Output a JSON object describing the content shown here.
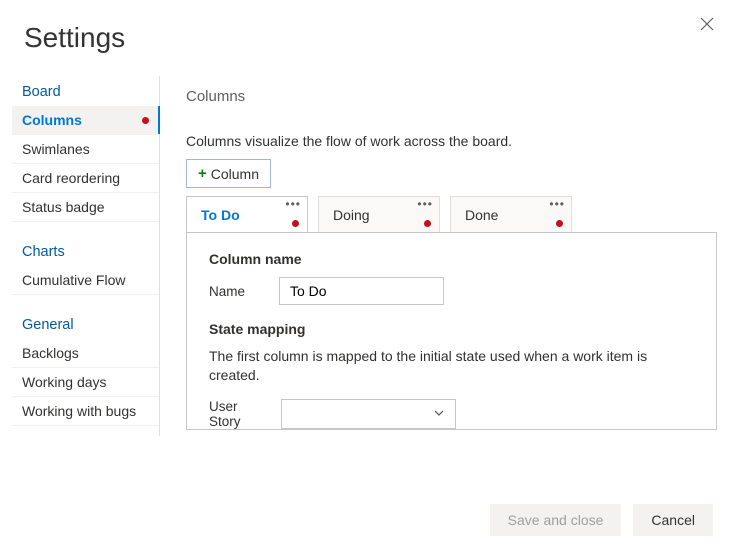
{
  "header": {
    "title": "Settings"
  },
  "sidebar": {
    "groups": [
      {
        "title": "Board",
        "items": [
          {
            "label": "Columns",
            "active": true,
            "error": true
          },
          {
            "label": "Swimlanes"
          },
          {
            "label": "Card reordering"
          },
          {
            "label": "Status badge"
          }
        ]
      },
      {
        "title": "Charts",
        "items": [
          {
            "label": "Cumulative Flow"
          }
        ]
      },
      {
        "title": "General",
        "items": [
          {
            "label": "Backlogs"
          },
          {
            "label": "Working days"
          },
          {
            "label": "Working with bugs"
          }
        ]
      }
    ]
  },
  "main": {
    "title": "Columns",
    "description": "Columns visualize the flow of work across the board.",
    "add_button_label": "Column",
    "tabs": [
      {
        "label": "To Do",
        "active": true,
        "error": true
      },
      {
        "label": "Doing",
        "error": true
      },
      {
        "label": "Done",
        "error": true
      }
    ],
    "column_name_section": "Column name",
    "name_label": "Name",
    "name_value": "To Do",
    "state_mapping_section": "State mapping",
    "state_mapping_desc": "The first column is mapped to the initial state used when a work item is created.",
    "user_story_label": "User Story",
    "user_story_value": ""
  },
  "footer": {
    "save_label": "Save and close",
    "cancel_label": "Cancel"
  }
}
